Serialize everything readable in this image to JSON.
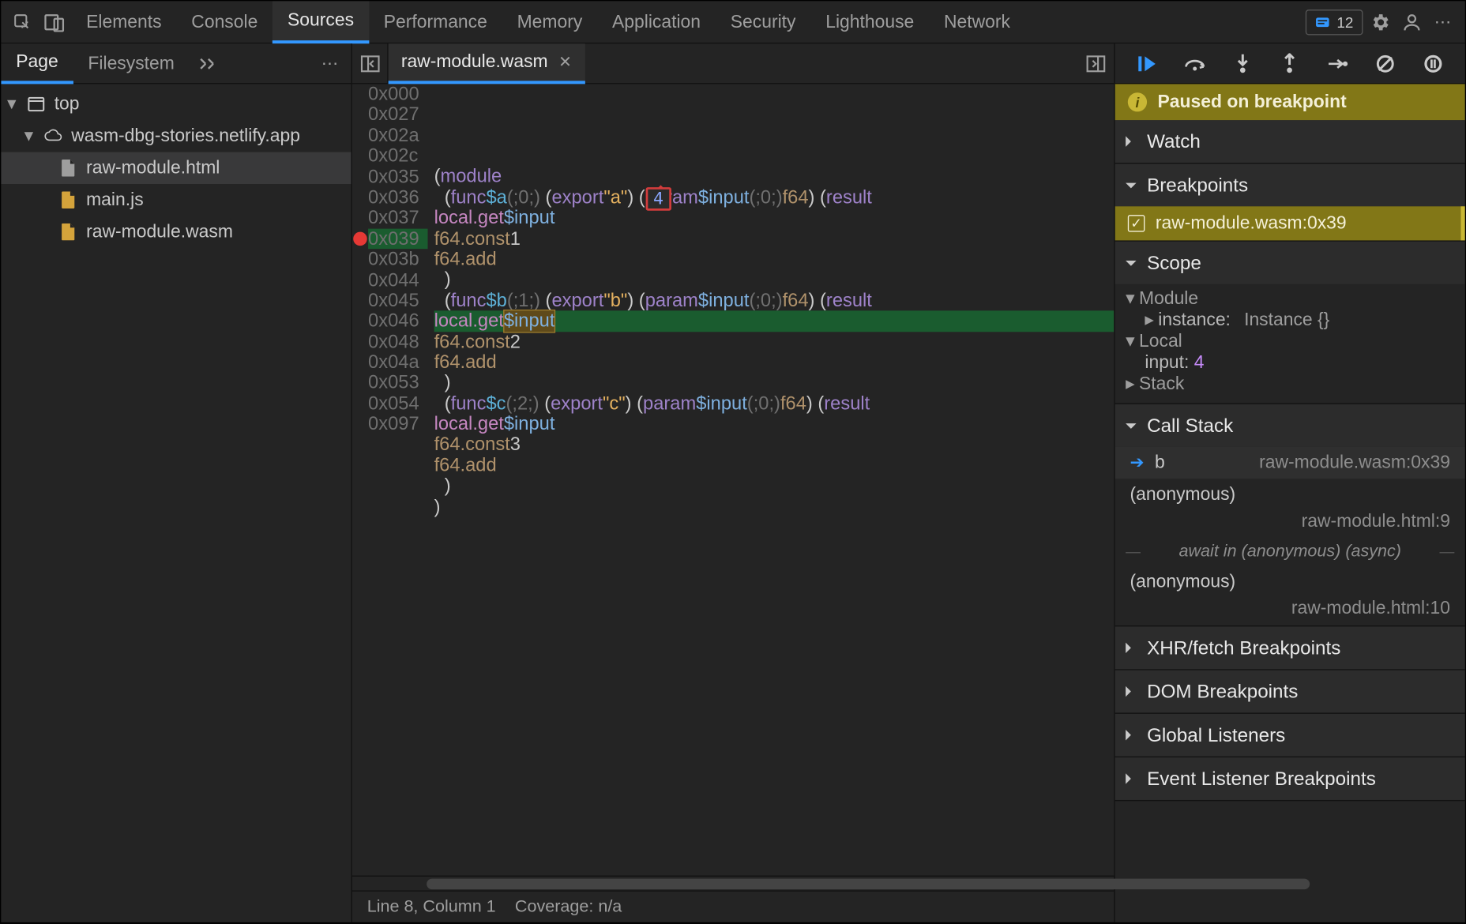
{
  "tabs": {
    "items": [
      "Elements",
      "Console",
      "Sources",
      "Performance",
      "Memory",
      "Application",
      "Security",
      "Lighthouse",
      "Network"
    ],
    "active": "Sources",
    "issues_count": "12"
  },
  "nav": {
    "tabs": [
      "Page",
      "Filesystem"
    ],
    "active": "Page",
    "tree": {
      "top": "top",
      "domain": "wasm-dbg-stories.netlify.app",
      "files": [
        "raw-module.html",
        "main.js",
        "raw-module.wasm"
      ],
      "selected": "raw-module.html"
    }
  },
  "editor": {
    "filename": "raw-module.wasm",
    "hover_value": "4",
    "breakpoint_addr": "0x039",
    "lines": [
      {
        "addr": "0x000",
        "html": "(<span class='kw'>module</span>"
      },
      {
        "addr": "0x027",
        "html": "  (<span class='kw'>func</span> <span class='fn'>$a</span> <span class='cm'>(;0;)</span> (<span class='kw'>export</span> <span class='str'>\"a\"</span>) (<span class='kw'>param</span> <span class='var'>$input</span> <span class='cm'>(;0;)</span> <span class='ty'>f64</span>) (<span class='kw'>result</span>"
      },
      {
        "addr": "0x02a",
        "html": "    <span class='mut'>local.get</span> <span class='var'>$input</span>"
      },
      {
        "addr": "0x02c",
        "html": "    <span class='ty'>f64.const</span> <span class='num'>1</span>"
      },
      {
        "addr": "0x035",
        "html": "    <span class='ty'>f64.add</span>"
      },
      {
        "addr": "0x036",
        "html": "  )"
      },
      {
        "addr": "0x037",
        "html": "  (<span class='kw'>func</span> <span class='fn'>$b</span> <span class='cm'>(;1;)</span> (<span class='kw'>export</span> <span class='str'>\"b\"</span>) (<span class='kw'>param</span> <span class='var'>$input</span> <span class='cm'>(;0;)</span> <span class='ty'>f64</span>) (<span class='kw'>result</span>"
      },
      {
        "addr": "0x039",
        "html": "    <span class='mut'>local.get</span> <span class='var sel-tok'>$input</span>",
        "exec": true,
        "bp": true
      },
      {
        "addr": "0x03b",
        "html": "    <span class='ty'>f64.const</span> <span class='num'>2</span>"
      },
      {
        "addr": "0x044",
        "html": "    <span class='ty'>f64.add</span>"
      },
      {
        "addr": "0x045",
        "html": "  )"
      },
      {
        "addr": "0x046",
        "html": "  (<span class='kw'>func</span> <span class='fn'>$c</span> <span class='cm'>(;2;)</span> (<span class='kw'>export</span> <span class='str'>\"c\"</span>) (<span class='kw'>param</span> <span class='var'>$input</span> <span class='cm'>(;0;)</span> <span class='ty'>f64</span>) (<span class='kw'>result</span>"
      },
      {
        "addr": "0x048",
        "html": "    <span class='mut'>local.get</span> <span class='var'>$input</span>"
      },
      {
        "addr": "0x04a",
        "html": "    <span class='ty'>f64.const</span> <span class='num'>3</span>"
      },
      {
        "addr": "0x053",
        "html": "    <span class='ty'>f64.add</span>"
      },
      {
        "addr": "0x054",
        "html": "  )"
      },
      {
        "addr": "0x097",
        "html": ")"
      }
    ],
    "status_line": "Line 8, Column 1",
    "status_cov": "Coverage: n/a"
  },
  "debugger": {
    "banner": "Paused on breakpoint",
    "sections": {
      "watch": "Watch",
      "breakpoints": "Breakpoints",
      "scope": "Scope",
      "callstack": "Call Stack",
      "xhr": "XHR/fetch Breakpoints",
      "dom": "DOM Breakpoints",
      "global": "Global Listeners",
      "event": "Event Listener Breakpoints"
    },
    "breakpoints": [
      {
        "label": "raw-module.wasm:0x39",
        "checked": true
      }
    ],
    "scope": {
      "module_label": "Module",
      "instance_k": "instance:",
      "instance_v": "Instance {}",
      "local_label": "Local",
      "input_k": "input:",
      "input_v": "4",
      "stack_label": "Stack"
    },
    "callstack": {
      "current_fn": "b",
      "current_loc": "raw-module.wasm:0x39",
      "anon1": "(anonymous)",
      "anon1_loc": "raw-module.html:9",
      "async_label": "await in (anonymous) (async)",
      "anon2": "(anonymous)",
      "anon2_loc": "raw-module.html:10"
    }
  }
}
